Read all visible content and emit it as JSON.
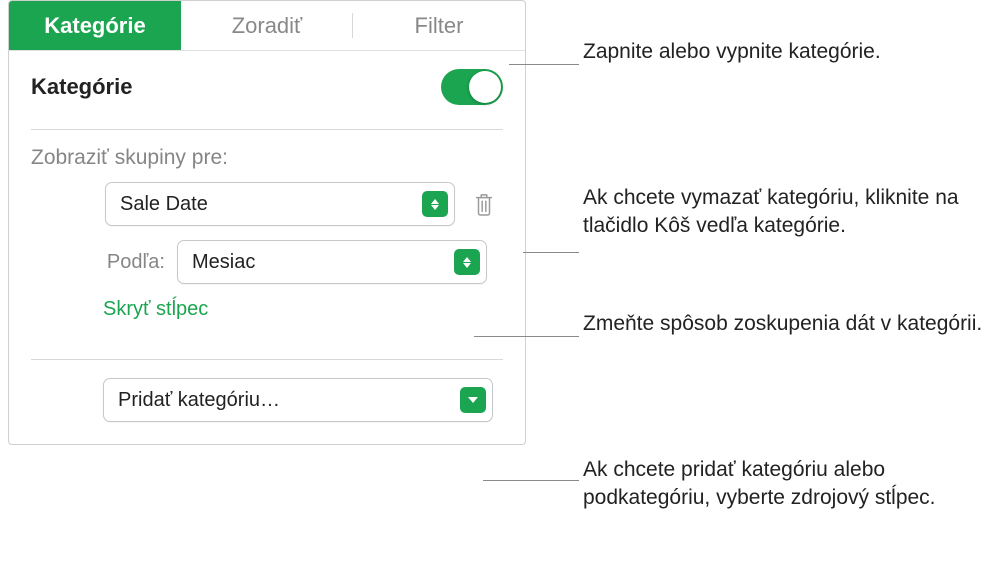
{
  "tabs": {
    "categories": "Kategórie",
    "sort": "Zoradiť",
    "filter": "Filter"
  },
  "section_title": "Kategórie",
  "toggle_on": true,
  "group_label": "Zobraziť skupiny pre:",
  "column_select": "Sale Date",
  "by_label": "Podľa:",
  "by_value": "Mesiac",
  "hide_column": "Skryť stĺpec",
  "add_category": "Pridať kategóriu…",
  "callouts": {
    "toggle": "Zapnite alebo vypnite kategórie.",
    "trash": "Ak chcete vymazať kategóriu, kliknite na tlačidlo Kôš vedľa kategórie.",
    "grouping": "Zmeňte spôsob zoskupenia dát v kategórii.",
    "add": "Ak chcete pridať kategóriu alebo podkategóriu, vyberte zdrojový stĺpec."
  }
}
